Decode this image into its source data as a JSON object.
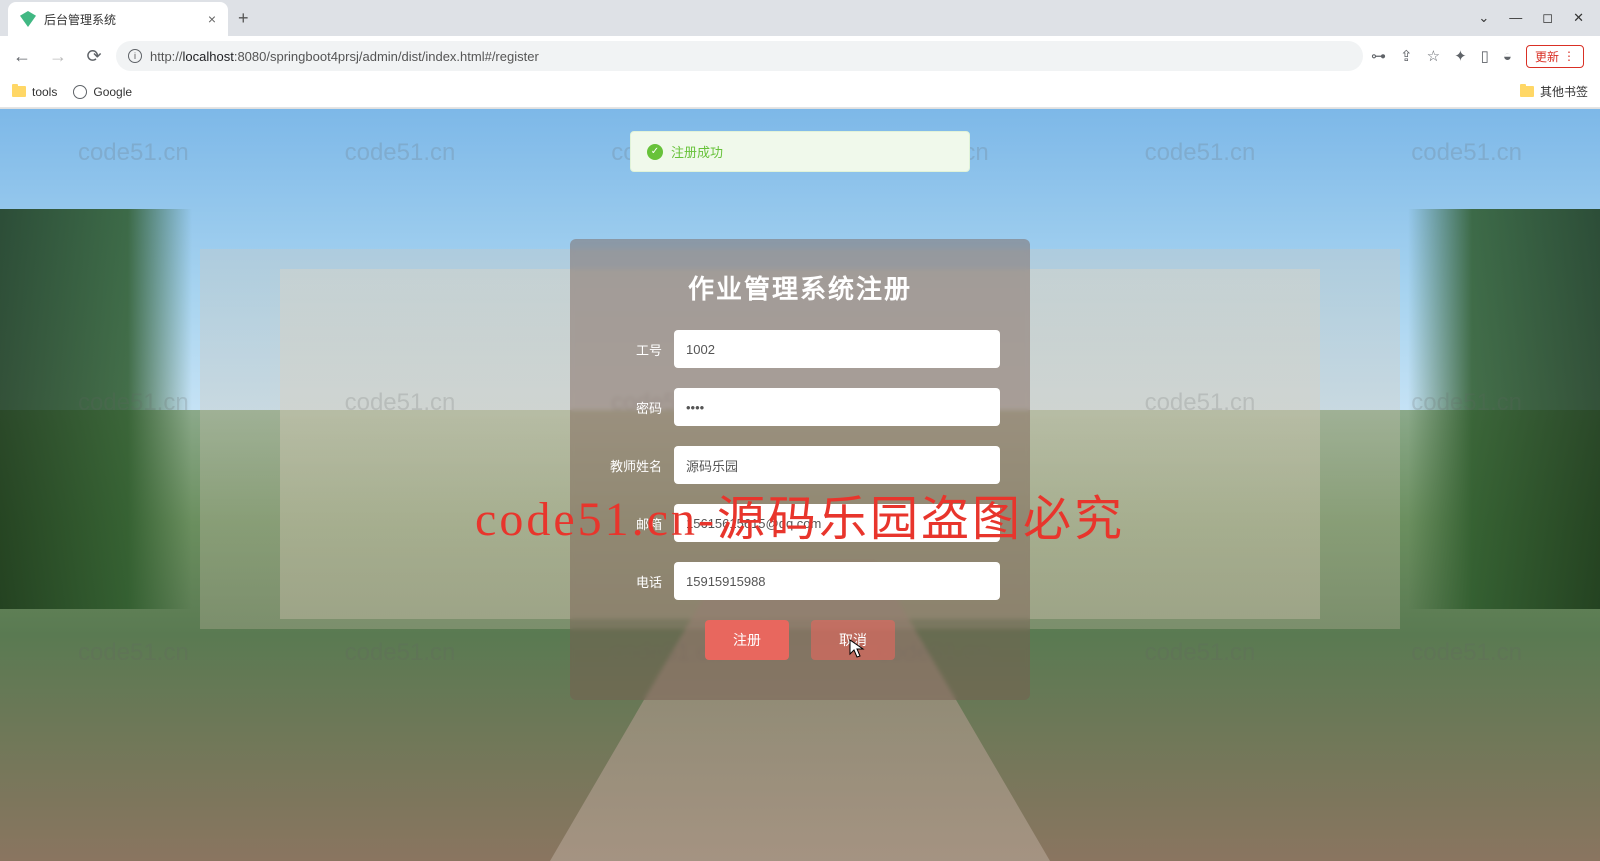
{
  "browser": {
    "tab_title": "后台管理系统",
    "url_prefix": "http://",
    "url_host": "localhost",
    "url_path": ":8080/springboot4prsj/admin/dist/index.html#/register",
    "update_label": "更新",
    "bookmarks": {
      "tools": "tools",
      "google": "Google",
      "other": "其他书签"
    }
  },
  "watermark": {
    "small": "code51.cn",
    "big": "code51.cn-源码乐园盗图必究"
  },
  "toast": {
    "message": "注册成功"
  },
  "form": {
    "title": "作业管理系统注册",
    "labels": {
      "id": "工号",
      "password": "密码",
      "teacher_name": "教师姓名",
      "email": "邮箱",
      "phone": "电话"
    },
    "values": {
      "id": "1002",
      "password": "••••",
      "teacher_name": "源码乐园",
      "email": "15615615615@qq.com",
      "phone": "15915915988"
    },
    "buttons": {
      "register": "注册",
      "cancel": "取消"
    }
  }
}
